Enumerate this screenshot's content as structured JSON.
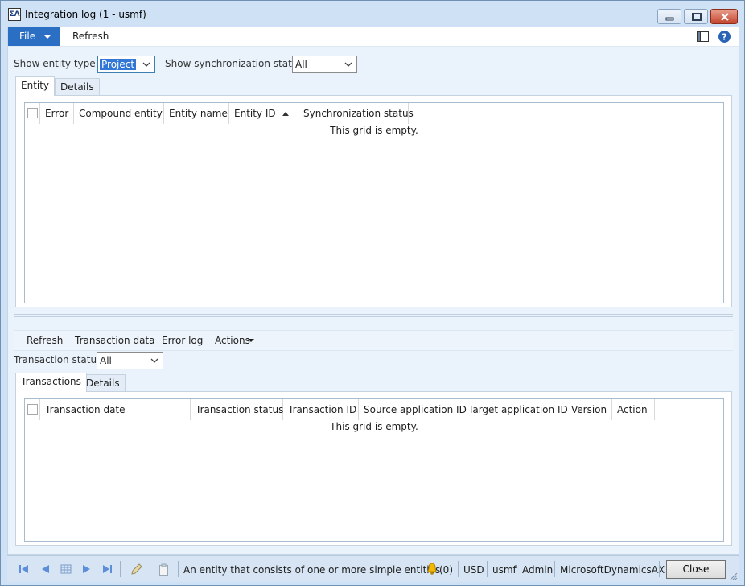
{
  "window": {
    "title": "Integration log (1 - usmf)",
    "app_icon_text": "ΣΛ"
  },
  "menubar": {
    "file_label": "File",
    "refresh_label": "Refresh"
  },
  "filters": {
    "entity_type_label": "Show entity type:",
    "entity_type_value": "Project",
    "sync_status_label": "Show synchronization status:",
    "sync_status_value": "All"
  },
  "top_tabs": [
    {
      "label": "Entity",
      "active": true
    },
    {
      "label": "Details",
      "active": false
    }
  ],
  "entity_grid": {
    "columns": [
      "Error",
      "Compound entity",
      "Entity name",
      "Entity ID",
      "Synchronization status"
    ],
    "sorted_column": "Entity ID",
    "empty_text": "This grid is empty."
  },
  "toolbar": {
    "refresh": "Refresh",
    "transaction_data": "Transaction data",
    "error_log": "Error log",
    "actions": "Actions"
  },
  "transaction_filter": {
    "label": "Transaction status:",
    "value": "All"
  },
  "bottom_tabs": [
    {
      "label": "Transactions",
      "active": true
    },
    {
      "label": "Details",
      "active": false
    }
  ],
  "transaction_grid": {
    "columns": [
      "Transaction date",
      "Transaction status",
      "Transaction ID",
      "Source application ID",
      "Target application ID",
      "Version",
      "Action"
    ],
    "empty_text": "This grid is empty."
  },
  "statusbar": {
    "help_text": "An entity that consists of one or more simple entities",
    "notifications": "(0)",
    "currency": "USD",
    "company": "usmf",
    "user": "Admin",
    "instance": "MicrosoftDynamicsAX",
    "close_label": "Close"
  },
  "colors": {
    "accent": "#2b6fc4",
    "frame": "#cfe2f5",
    "panel": "#eaf2fb"
  }
}
